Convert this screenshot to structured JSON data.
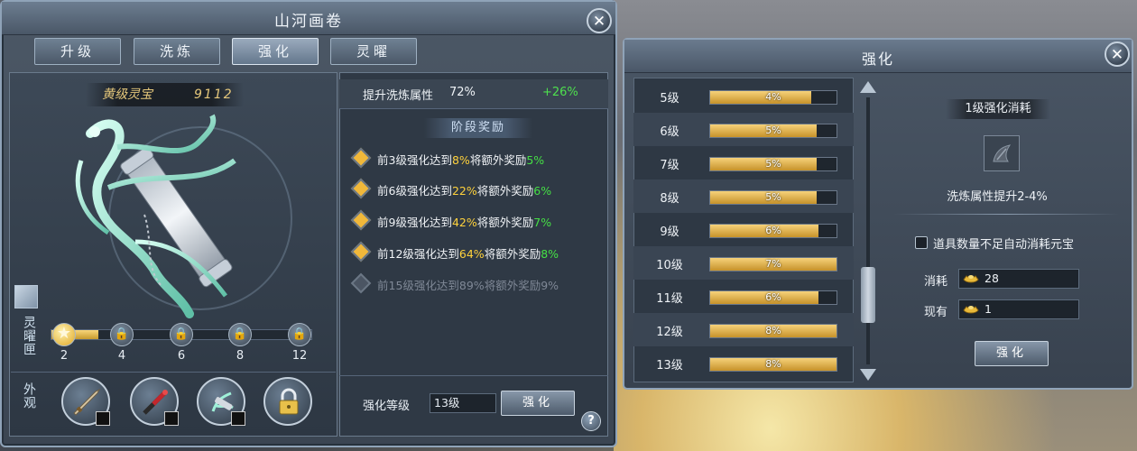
{
  "left_panel": {
    "title": "山河画卷",
    "close_label": "✕",
    "tabs": [
      {
        "label": "升级"
      },
      {
        "label": "洗炼"
      },
      {
        "label": "强化",
        "active": true
      },
      {
        "label": "灵曜"
      }
    ],
    "item": {
      "grade_name": "黄级灵宝",
      "score": "9112"
    },
    "lingyao_label": "灵曜匣",
    "appearance_label": "外观",
    "progress": {
      "fraction": 0.18,
      "nodes": [
        {
          "label": "2",
          "state": "star"
        },
        {
          "label": "4",
          "state": "locked"
        },
        {
          "label": "6",
          "state": "locked"
        },
        {
          "label": "8",
          "state": "locked"
        },
        {
          "label": "12",
          "state": "locked"
        }
      ]
    },
    "appearance_slots": [
      {
        "icon": "sword-icon"
      },
      {
        "icon": "red-weapon-icon"
      },
      {
        "icon": "phoenix-icon"
      },
      {
        "icon": "lock-icon"
      }
    ],
    "attr": {
      "label": "提升洗炼属性",
      "value": "72%",
      "bonus": "+26%"
    },
    "stage_title": "阶段奖励",
    "rewards": [
      {
        "pre": "前3级强化达到",
        "pct": "8%",
        "mid": "将额外奖励",
        "bonus": "5%",
        "unlocked": true
      },
      {
        "pre": "前6级强化达到",
        "pct": "22%",
        "mid": "将额外奖励",
        "bonus": "6%",
        "unlocked": true
      },
      {
        "pre": "前9级强化达到",
        "pct": "42%",
        "mid": "将额外奖励",
        "bonus": "7%",
        "unlocked": true
      },
      {
        "pre": "前12级强化达到",
        "pct": "64%",
        "mid": "将额外奖励",
        "bonus": "8%",
        "unlocked": true
      },
      {
        "pre": "前15级强化达到",
        "pct": "89%",
        "mid": "将额外奖励",
        "bonus": "9%",
        "unlocked": false
      }
    ],
    "level_label": "强化等级",
    "level_value": "13级",
    "enhance_button": "强化",
    "help_label": "?"
  },
  "right_panel": {
    "title": "强化",
    "close_label": "✕",
    "levels": [
      {
        "label": "5级",
        "text": "4%",
        "fill": 0.8
      },
      {
        "label": "6级",
        "text": "5%",
        "fill": 0.84
      },
      {
        "label": "7级",
        "text": "5%",
        "fill": 0.84
      },
      {
        "label": "8级",
        "text": "5%",
        "fill": 0.84
      },
      {
        "label": "9级",
        "text": "6%",
        "fill": 0.86
      },
      {
        "label": "10级",
        "text": "7%",
        "fill": 1.0
      },
      {
        "label": "11级",
        "text": "6%",
        "fill": 0.86
      },
      {
        "label": "12级",
        "text": "8%",
        "fill": 1.0
      },
      {
        "label": "13级",
        "text": "8%",
        "fill": 1.0
      }
    ],
    "cost_title": "1级强化消耗",
    "effect": "洗炼属性提升2-4%",
    "auto_consume_label": "道具数量不足自动消耗元宝",
    "consume_label": "消耗",
    "consume_value": "28",
    "owned_label": "现有",
    "owned_value": "1",
    "enhance_button": "强化"
  }
}
